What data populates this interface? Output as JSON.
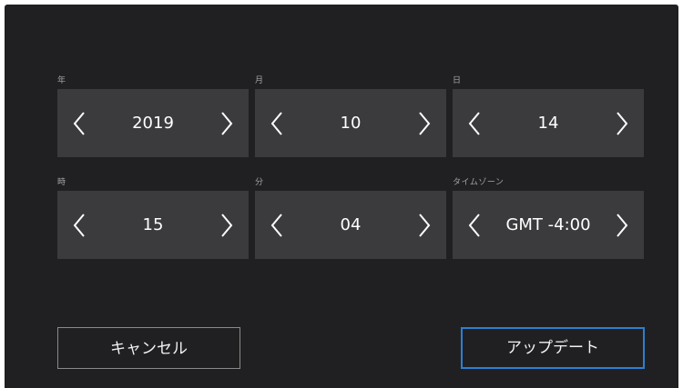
{
  "fields": [
    {
      "label": "年",
      "value": "2019"
    },
    {
      "label": "月",
      "value": "10"
    },
    {
      "label": "日",
      "value": "14"
    },
    {
      "label": "時",
      "value": "15"
    },
    {
      "label": "分",
      "value": "04"
    },
    {
      "label": "タイムゾーン",
      "value": "GMT -4:00"
    }
  ],
  "buttons": {
    "cancel_label": "キャンセル",
    "update_label": "アップデート"
  },
  "colors": {
    "background": "#202022",
    "stepper": "#3b3b3e",
    "accent": "#2d7fd2"
  },
  "icons": {
    "decrement": "chevron-left-icon",
    "increment": "chevron-right-icon"
  }
}
